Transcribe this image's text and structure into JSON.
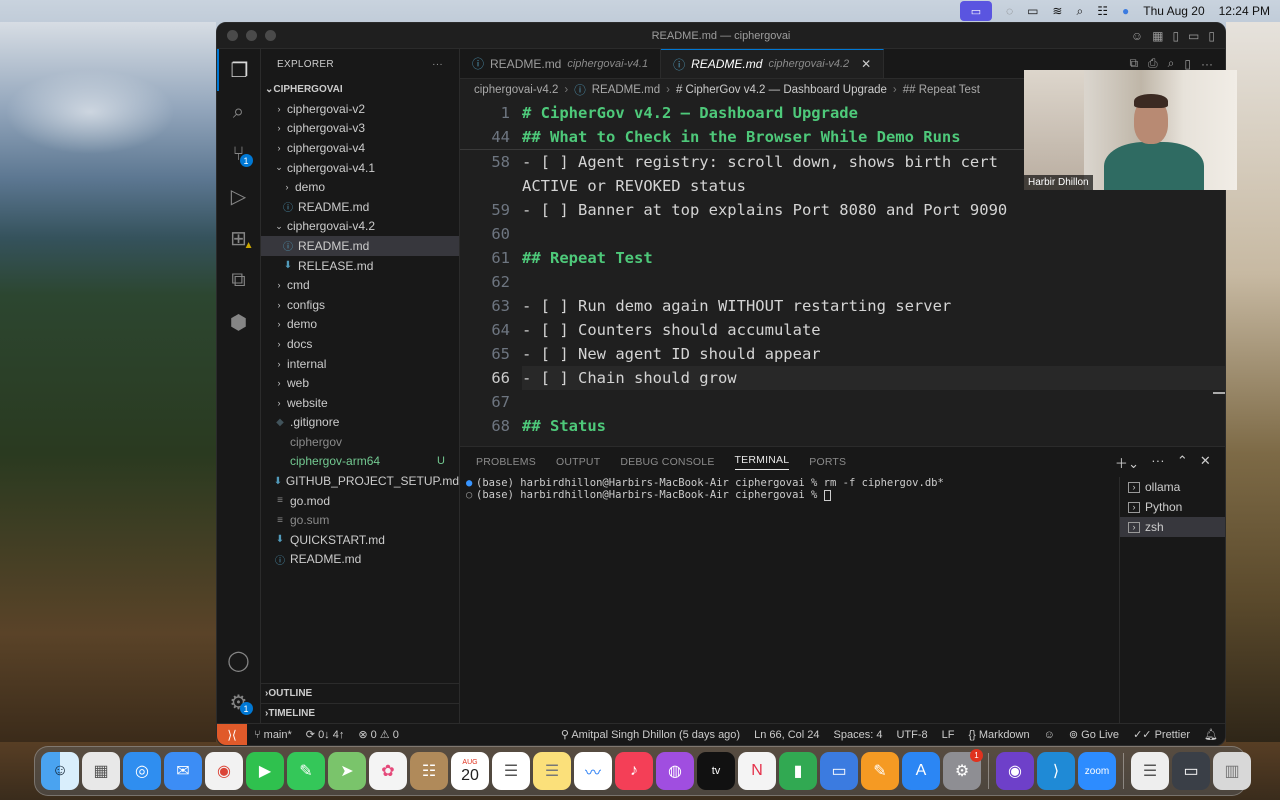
{
  "menubar": {
    "date": "Thu Aug 20",
    "time": "12:24 PM"
  },
  "window": {
    "title": "README.md — ciphergovai"
  },
  "sidebar": {
    "header": "EXPLORER",
    "root": "CIPHERGOVAI",
    "items": [
      {
        "label": "ciphergovai-v2",
        "type": "folder",
        "open": false,
        "depth": 1
      },
      {
        "label": "ciphergovai-v3",
        "type": "folder",
        "open": false,
        "depth": 1
      },
      {
        "label": "ciphergovai-v4",
        "type": "folder",
        "open": false,
        "depth": 1
      },
      {
        "label": "ciphergovai-v4.1",
        "type": "folder",
        "open": true,
        "depth": 1
      },
      {
        "label": "demo",
        "type": "folder",
        "open": false,
        "depth": 2
      },
      {
        "label": "README.md",
        "type": "info",
        "depth": 2
      },
      {
        "label": "ciphergovai-v4.2",
        "type": "folder",
        "open": true,
        "depth": 1
      },
      {
        "label": "README.md",
        "type": "info",
        "depth": 2,
        "selected": true
      },
      {
        "label": "RELEASE.md",
        "type": "md",
        "depth": 2
      },
      {
        "label": "cmd",
        "type": "folder",
        "open": false,
        "depth": 1
      },
      {
        "label": "configs",
        "type": "folder",
        "open": false,
        "depth": 1
      },
      {
        "label": "demo",
        "type": "folder",
        "open": false,
        "depth": 1
      },
      {
        "label": "docs",
        "type": "folder",
        "open": false,
        "depth": 1
      },
      {
        "label": "internal",
        "type": "folder",
        "open": false,
        "depth": 1
      },
      {
        "label": "web",
        "type": "folder",
        "open": false,
        "depth": 1
      },
      {
        "label": "website",
        "type": "folder",
        "open": false,
        "depth": 1
      },
      {
        "label": ".gitignore",
        "type": "git",
        "depth": 1
      },
      {
        "label": "ciphergov",
        "type": "file",
        "depth": 1,
        "dim": true
      },
      {
        "label": "ciphergov-arm64",
        "type": "file",
        "depth": 1,
        "green": true,
        "status": "U"
      },
      {
        "label": "GITHUB_PROJECT_SETUP.md",
        "type": "md",
        "depth": 1
      },
      {
        "label": "go.mod",
        "type": "go",
        "depth": 1
      },
      {
        "label": "go.sum",
        "type": "go",
        "depth": 1,
        "dim": true
      },
      {
        "label": "QUICKSTART.md",
        "type": "md",
        "depth": 1
      },
      {
        "label": "README.md",
        "type": "info",
        "depth": 1
      }
    ],
    "outline": "OUTLINE",
    "timeline": "TIMELINE"
  },
  "tabs": [
    {
      "label": "README.md",
      "desc": "ciphergovai-v4.1",
      "active": false
    },
    {
      "label": "README.md",
      "desc": "ciphergovai-v4.2",
      "active": true
    }
  ],
  "breadcrumb": [
    "ciphergovai-v4.2",
    "README.md",
    "# CipherGov v4.2 — Dashboard Upgrade",
    "## Repeat Test"
  ],
  "code": {
    "sticky": [
      {
        "n": "1",
        "text": "# CipherGov v4.2 — Dashboard Upgrade",
        "heading": true
      },
      {
        "n": "44",
        "text": "## What to Check in the Browser While Demo Runs",
        "heading": true
      }
    ],
    "lines": [
      {
        "n": "58",
        "text": "- [ ] Agent registry: scroll down, shows birth cert",
        "heading": false
      },
      {
        "n": "",
        "text": "ACTIVE or REVOKED status",
        "heading": false
      },
      {
        "n": "59",
        "text": "- [ ] Banner at top explains Port 8080 and Port 9090",
        "heading": false
      },
      {
        "n": "60",
        "text": "",
        "heading": false
      },
      {
        "n": "61",
        "text": "## Repeat Test",
        "heading": true
      },
      {
        "n": "62",
        "text": "",
        "heading": false
      },
      {
        "n": "63",
        "text": "- [ ] Run demo again WITHOUT restarting server",
        "heading": false
      },
      {
        "n": "64",
        "text": "- [ ] Counters should accumulate",
        "heading": false
      },
      {
        "n": "65",
        "text": "- [ ] New agent ID should appear",
        "heading": false
      },
      {
        "n": "66",
        "text": "- [ ] Chain should grow",
        "heading": false,
        "current": true
      },
      {
        "n": "67",
        "text": "",
        "heading": false
      },
      {
        "n": "68",
        "text": "## Status",
        "heading": true
      }
    ]
  },
  "panel": {
    "tabs": [
      "PROBLEMS",
      "OUTPUT",
      "DEBUG CONSOLE",
      "TERMINAL",
      "PORTS"
    ],
    "active_tab": "TERMINAL",
    "terminal_lines": [
      {
        "dot": "blue",
        "text": "(base) harbirdhillon@Harbirs-MacBook-Air ciphergovai % rm -f ciphergov.db*"
      },
      {
        "dot": "gray",
        "text": "(base) harbirdhillon@Harbirs-MacBook-Air ciphergovai % "
      }
    ],
    "terminals": [
      "ollama",
      "Python",
      "zsh"
    ],
    "selected_terminal": "zsh"
  },
  "statusbar": {
    "branch": "main*",
    "sync": "0↓ 4↑",
    "problems": "⊗ 0 ⚠ 0",
    "blame": "Amitpal Singh Dhillon (5 days ago)",
    "position": "Ln 66, Col 24",
    "spaces": "Spaces: 4",
    "encoding": "UTF-8",
    "eol": "LF",
    "language": "Markdown",
    "golive": "Go Live",
    "prettier": "Prettier"
  },
  "video": {
    "name": "Harbir Dhillon"
  },
  "dock": {
    "calendar_month": "AUG",
    "calendar_day": "20",
    "badge_settings": "1"
  },
  "activity_badges": {
    "scm": "1",
    "accounts": "1"
  }
}
